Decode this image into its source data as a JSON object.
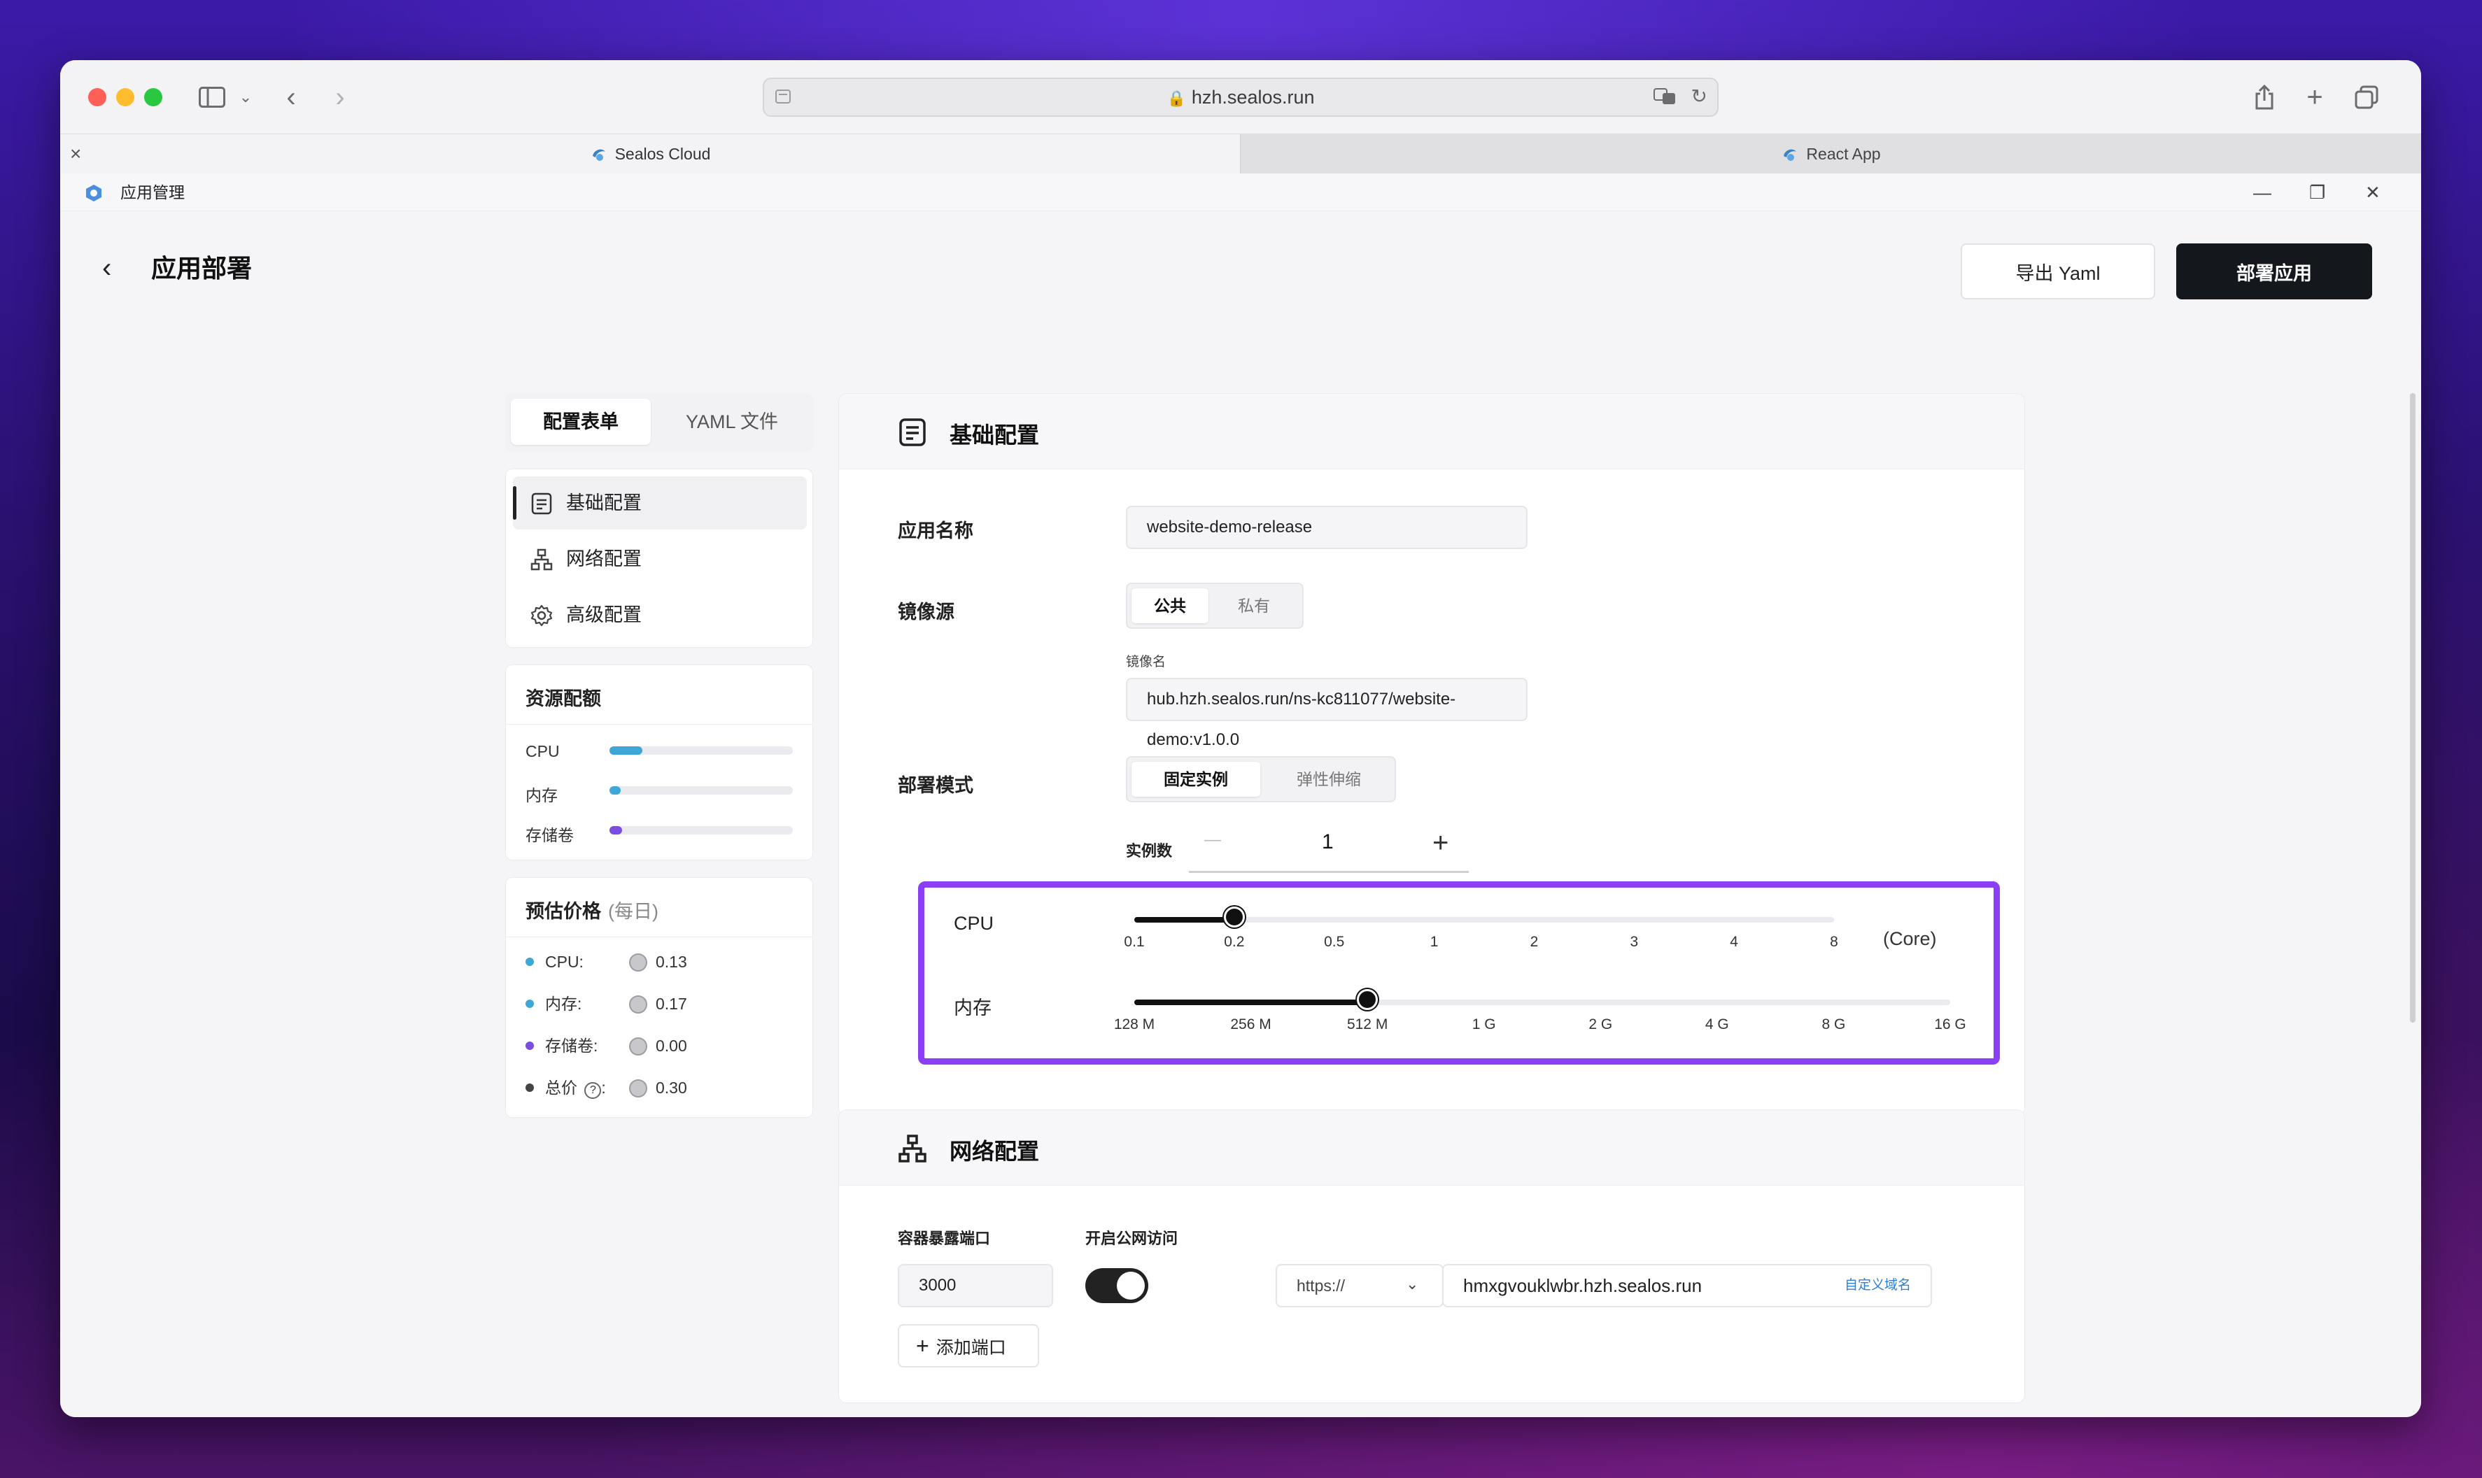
{
  "browser": {
    "url": "hzh.sealos.run",
    "tabs": [
      {
        "label": "Sealos Cloud",
        "active": true
      },
      {
        "label": "React App",
        "active": false
      }
    ],
    "tab_close": "×"
  },
  "app": {
    "title": "应用管理",
    "window_controls": {
      "minimize": "—",
      "restore": "❐",
      "close": "✕"
    }
  },
  "header": {
    "back": "‹",
    "title": "应用部署",
    "export_label": "导出 Yaml",
    "deploy_label": "部署应用"
  },
  "sidebar": {
    "mode_tabs": [
      "配置表单",
      "YAML 文件"
    ],
    "nav": [
      {
        "label": "基础配置",
        "icon": "document-icon",
        "active": true
      },
      {
        "label": "网络配置",
        "icon": "network-icon",
        "active": false
      },
      {
        "label": "高级配置",
        "icon": "gear-icon",
        "active": false
      }
    ],
    "resources": {
      "title": "资源配额",
      "items": [
        {
          "label": "CPU",
          "fraction": 0.18,
          "color": "#3fa7d6"
        },
        {
          "label": "内存",
          "fraction": 0.06,
          "color": "#3fa7d6"
        },
        {
          "label": "存储卷",
          "fraction": 0.07,
          "color": "#7b4ce0"
        }
      ]
    },
    "price": {
      "title": "预估价格",
      "subtitle": "(每日)",
      "items": [
        {
          "label": "CPU:",
          "value": "0.13",
          "color": "#3fa7d6"
        },
        {
          "label": "内存:",
          "value": "0.17",
          "color": "#3fa7d6"
        },
        {
          "label": "存储卷:",
          "value": "0.00",
          "color": "#7b4ce0"
        },
        {
          "label": "总价",
          "help": "?",
          "suffix": ":",
          "value": "0.30",
          "color": "#444444"
        }
      ]
    }
  },
  "basic": {
    "title": "基础配置",
    "app_name_label": "应用名称",
    "app_name_value": "website-demo-release",
    "image_source_label": "镜像源",
    "image_source_options": [
      "公共",
      "私有"
    ],
    "image_name_label": "镜像名",
    "image_name_value": "hub.hzh.sealos.run/ns-kc811077/website-demo:v1.0.0",
    "deploy_mode_label": "部署模式",
    "deploy_mode_options": [
      "固定实例",
      "弹性伸缩"
    ],
    "instances_label": "实例数",
    "instances_value": "1",
    "minus": "—",
    "plus": "+",
    "cpu": {
      "label": "CPU",
      "ticks": [
        "0.1",
        "0.2",
        "0.5",
        "1",
        "2",
        "3",
        "4",
        "8"
      ],
      "selected_index": 1,
      "unit": "(Core)"
    },
    "memory": {
      "label": "内存",
      "ticks": [
        "128 M",
        "256 M",
        "512 M",
        "1 G",
        "2 G",
        "4 G",
        "8 G",
        "16 G"
      ],
      "selected_index": 2
    }
  },
  "network": {
    "title": "网络配置",
    "port_label": "容器暴露端口",
    "port_value": "3000",
    "public_label": "开启公网访问",
    "public_enabled": true,
    "protocol": "https://",
    "domain": "hmxgvouklwbr.hzh.sealos.run",
    "custom_domain": "自定义域名",
    "add_port": "添加端口"
  },
  "colors": {
    "highlight": "#8a3ff7",
    "accent_dark": "#14171c",
    "link": "#2f7ed8"
  }
}
